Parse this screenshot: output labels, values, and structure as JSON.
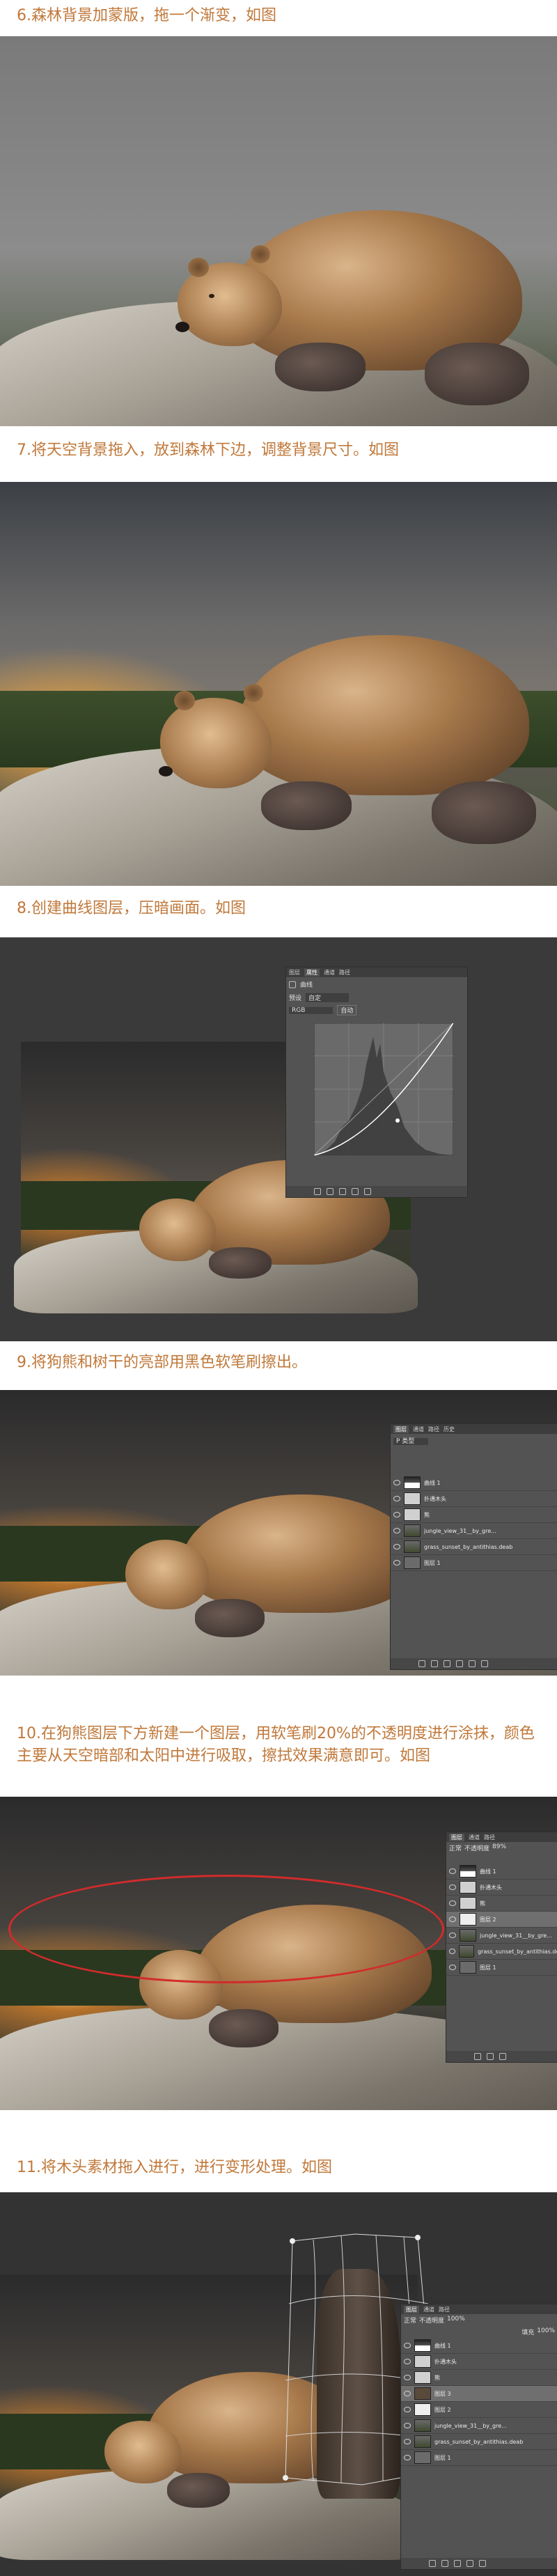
{
  "steps": [
    {
      "caption": "6.森林背景加蒙版，拖一个渐变，如图"
    },
    {
      "caption": "7.将天空背景拖入，放到森林下边，调整背景尺寸。如图"
    },
    {
      "caption": "8.创建曲线图层，压暗画面。如图"
    },
    {
      "caption": "9.将狗熊和树干的亮部用黑色软笔刷擦出。"
    },
    {
      "caption": "10.在狗熊图层下方新建一个图层，用软笔刷20%的不透明度进行涂抹，颜色主要从天空暗部和太阳中进行吸取，擦拭效果满意即可。如图"
    },
    {
      "caption": "11.将木头素材拖入进行，进行变形处理。如图"
    }
  ],
  "curves_panel": {
    "tabs": [
      "图层",
      "属性",
      "通道",
      "路径"
    ],
    "title": "曲线",
    "preset_label": "预设",
    "preset_value": "自定",
    "channel_value": "RGB",
    "auto_label": "自动"
  },
  "layers_panel_9": {
    "tabs": [
      "图层",
      "通道",
      "路径",
      "历史"
    ],
    "kind_label": "P 类型",
    "layers": [
      "曲线 1",
      "扑通木头",
      "熊",
      "jungle_view_31__by_gre...",
      "grass_sunset_by_antithias.deab",
      "图层 1"
    ]
  },
  "layers_panel_10": {
    "tabs": [
      "图层",
      "通道",
      "路径"
    ],
    "blend": "正常",
    "opacity_label": "不透明度",
    "opacity": "89%",
    "layers": [
      "曲线 1",
      "扑通木头",
      "熊",
      "图层 2",
      "jungle_view_31__by_gre...",
      "grass_sunset_by_antithias.deab",
      "图层 1"
    ]
  },
  "layers_panel_11": {
    "tabs": [
      "图层",
      "通道",
      "路径"
    ],
    "blend": "正常",
    "opacity_label": "不透明度",
    "opacity": "100%",
    "fill_label": "填充",
    "fill": "100%",
    "layers": [
      "曲线 1",
      "扑通木头",
      "熊",
      "图层 3",
      "图层 2",
      "jungle_view_31__by_gre...",
      "grass_sunset_by_antithias.deab",
      "图层 1"
    ]
  }
}
